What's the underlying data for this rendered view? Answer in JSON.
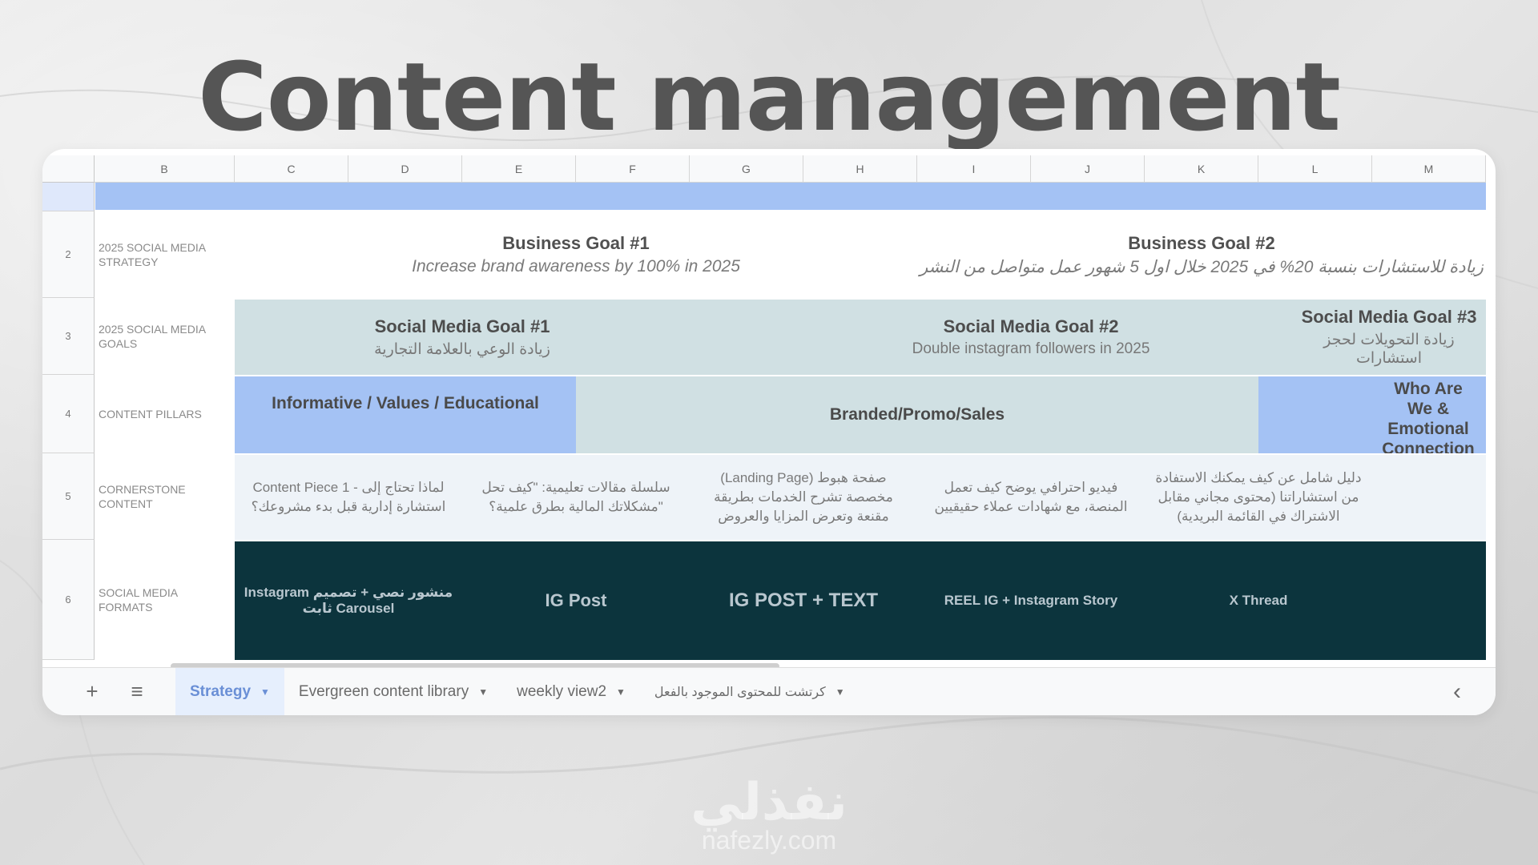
{
  "title": "Content management",
  "columns": [
    "B",
    "C",
    "D",
    "E",
    "F",
    "G",
    "H",
    "I",
    "J",
    "K",
    "L",
    "M"
  ],
  "rows": [
    {
      "num": "2",
      "label": "2025 SOCIAL MEDIA STRATEGY"
    },
    {
      "num": "3",
      "label": "2025 SOCIAL MEDIA GOALS"
    },
    {
      "num": "4",
      "label": "CONTENT PILLARS"
    },
    {
      "num": "5",
      "label": "CORNERSTONE CONTENT"
    },
    {
      "num": "6",
      "label": "SOCIAL MEDIA FORMATS"
    }
  ],
  "business_goals": [
    {
      "title": "Business Goal #1",
      "subtitle": "Increase brand awareness by 100% in 2025"
    },
    {
      "title": "Business Goal #2",
      "subtitle": "زيادة للاستشارات بنسبة 20% في 2025 خلال اول 5 شهور عمل متواصل من النشر"
    }
  ],
  "social_media_goals": [
    {
      "title": "Social Media Goal #1",
      "subtitle": "زيادة الوعي بالعلامة التجارية"
    },
    {
      "title": "Social Media Goal #2",
      "subtitle": "Double instagram followers in 2025"
    },
    {
      "title": "Social Media Goal #3",
      "subtitle": "زيادة التحويلات لحجز استشارات"
    }
  ],
  "content_pillars": [
    {
      "label": "Informative / Values / Educational",
      "color": "#a4c2f4"
    },
    {
      "label": "Branded/Promo/Sales",
      "color": "#d0e0e3"
    },
    {
      "label": "Who Are We & Emotional Connection",
      "color": "#a4c2f4"
    }
  ],
  "cornerstone_content": [
    "Content Piece 1 - لماذا تحتاج إلى استشارة إدارية قبل بدء مشروعك؟",
    "سلسلة مقالات تعليمية: \"كيف تحل مشكلاتك المالية بطرق علمية؟\"",
    "(Landing Page) صفحة هبوط مخصصة تشرح الخدمات بطريقة مقنعة وتعرض المزايا والعروض",
    "فيديو احترافي يوضح كيف تعمل المنصة، مع شهادات عملاء حقيقيين",
    "دليل شامل عن كيف يمكنك الاستفادة من استشاراتنا (محتوى مجاني مقابل الاشتراك في القائمة البريدية)"
  ],
  "social_media_formats": [
    "Instagram منشور نصي + تصميم ثابت Carousel",
    "IG Post",
    "IG POST + TEXT",
    "REEL IG + Instagram Story",
    "X Thread"
  ],
  "tabs": {
    "add_icon": "+",
    "menu_icon": "≡",
    "items": [
      "Strategy",
      "Evergreen content library",
      "weekly view2",
      "كرتشت للمحتوى الموجود بالفعل"
    ],
    "collapse_icon": "‹"
  },
  "watermark": {
    "arabic": "نفذلي",
    "latin": "nafezly.com"
  },
  "colors": {
    "header_band": "#a4c2f4",
    "goals_bg": "#d0e0e3",
    "formats_bg": "#0c343d"
  }
}
